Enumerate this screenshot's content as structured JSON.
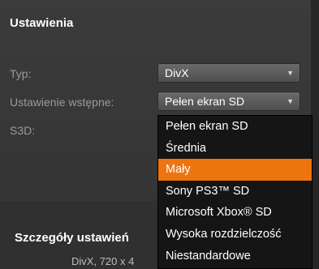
{
  "settings": {
    "title": "Ustawienia",
    "type": {
      "label": "Typ:",
      "value": "DivX"
    },
    "preset": {
      "label": "Ustawienie wstępne:",
      "value": "Pełen ekran SD"
    },
    "s3d": {
      "label": "S3D:"
    }
  },
  "dropdown": {
    "items": [
      "Pełen ekran SD",
      "Średnia",
      "Mały",
      "Sony PS3™ SD",
      "Microsoft Xbox® SD",
      "Wysoka rozdzielczość",
      "Niestandardowe"
    ],
    "highlighted": "Mały"
  },
  "details": {
    "title": "Szczegóły ustawień",
    "partial_text": "DivX, 720 x 4"
  },
  "colors": {
    "highlight": "#ee7410",
    "panel": "#393939",
    "menu_bg": "#151515"
  }
}
